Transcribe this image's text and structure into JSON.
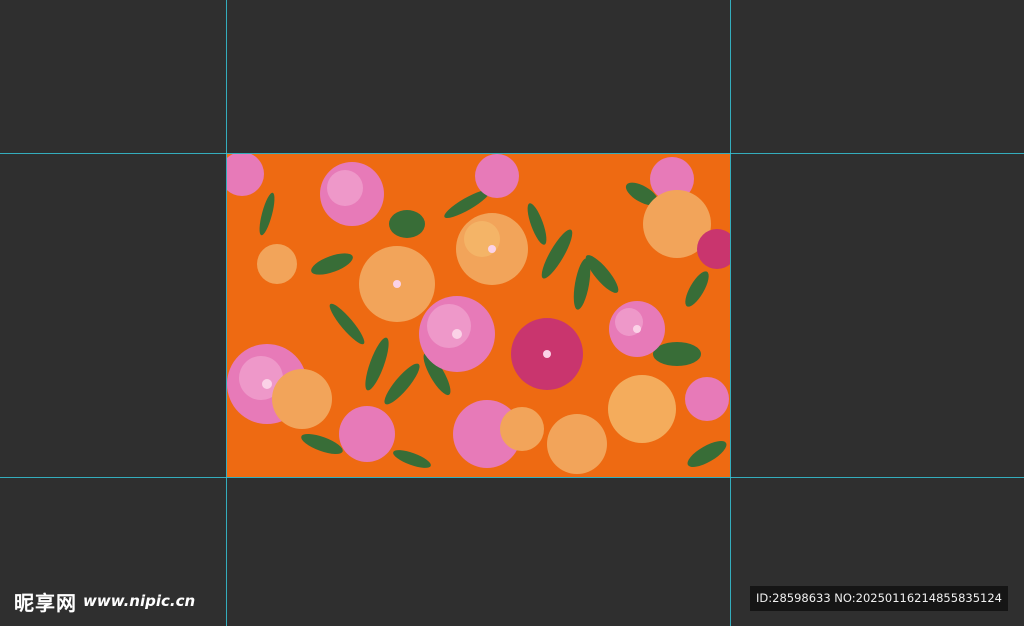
{
  "workspace": {
    "background_color": "#2f2f2f",
    "guide_color": "#35c3d6"
  },
  "artwork": {
    "background_color": "#ee6a12",
    "petal_colors": [
      "#e77ab8",
      "#f0a3cf",
      "#f2a45a",
      "#c9356e",
      "#f4b76a"
    ],
    "leaf_color": "#2f6e3a"
  },
  "watermark": {
    "site_name": "昵享网",
    "site_url": "www.nipic.cn",
    "id_text": "ID:28598633 NO:20250116214855835124"
  }
}
